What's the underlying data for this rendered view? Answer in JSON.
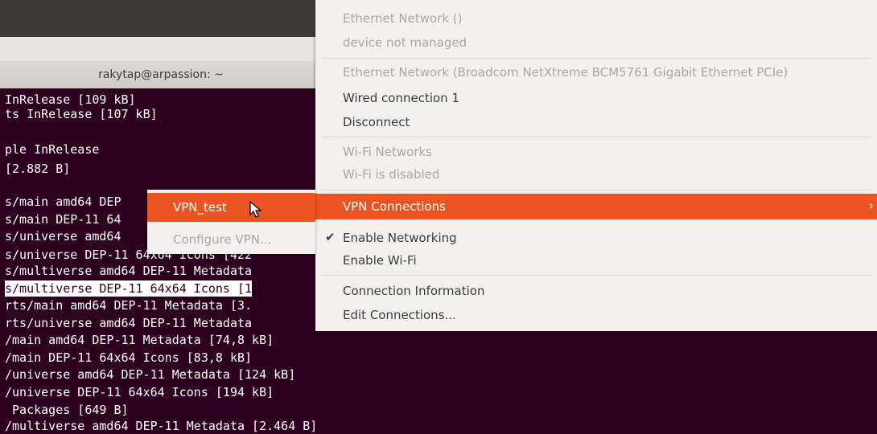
{
  "terminal": {
    "title": "rakytap@arpassion: ~",
    "lines": [
      "InRelease [109 kB]",
      "ts InRelease [107 kB]",
      "",
      "ple InRelease",
      "[2.882 B]",
      "",
      "s/main amd64 DEP",
      "s/main DEP-11 64",
      "s/universe amd64",
      "s/universe DEP-11 64x64 Icons [422",
      "s/multiverse amd64 DEP-11 Metadata",
      "s/multiverse DEP-11 64x64 Icons [1",
      "rts/main amd64 DEP-11 Metadata [3.",
      "rts/universe amd64 DEP-11 Metadata",
      "/main amd64 DEP-11 Metadata [74,8 kB]",
      "/main DEP-11 64x64 Icons [83,8 kB]",
      "/universe amd64 DEP-11 Metadata [124 kB]",
      "/universe DEP-11 64x64 Icons [194 kB]",
      " Packages [649 B]",
      "/multiverse amd64 DEP-11 Metadata [2.464 B]"
    ]
  },
  "network_menu": {
    "ethernet1_header": "Ethernet Network ()",
    "ethernet1_status": "device not managed",
    "ethernet2_header": "Ethernet Network (Broadcom NetXtreme BCM5761 Gigabit Ethernet PCIe)",
    "wired_connection": "Wired connection 1",
    "disconnect": "Disconnect",
    "wifi_header": "Wi-Fi Networks",
    "wifi_status": "Wi-Fi is disabled",
    "vpn_connections": "VPN Connections",
    "vpn_arrow": "›",
    "enable_networking": "Enable Networking",
    "enable_networking_check": "✔",
    "enable_wifi": "Enable Wi-Fi",
    "connection_info": "Connection Information",
    "edit_connections": "Edit Connections..."
  },
  "vpn_submenu": {
    "vpn_test": "VPN_test",
    "configure_vpn": "Configure VPN..."
  },
  "colors": {
    "accent": "#e95420",
    "terminal_bg": "#2c001e",
    "menu_bg": "#f2f1f0"
  },
  "icons": {
    "cursor": "mouse-pointer-icon"
  }
}
